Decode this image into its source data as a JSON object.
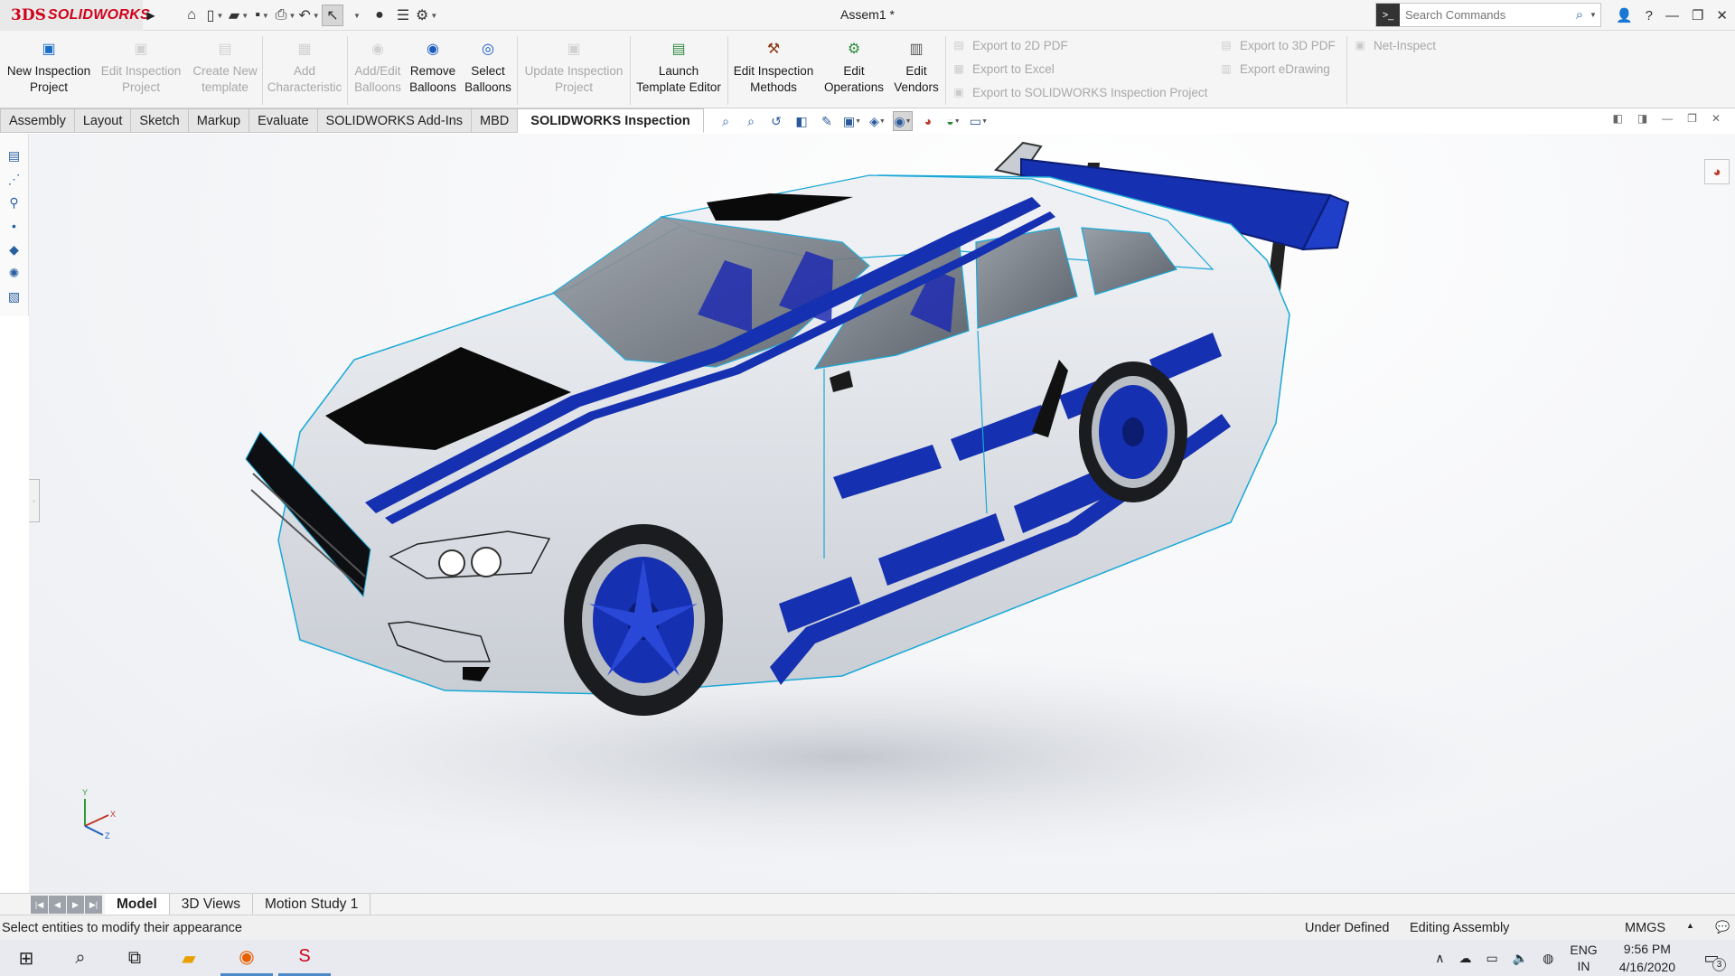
{
  "app": {
    "brand_mark": "3DS",
    "brand_name": "SOLIDWORKS",
    "document_title": "Assem1 *"
  },
  "search": {
    "placeholder": "Search Commands"
  },
  "quick_toolbar": {
    "icons": [
      "home-icon",
      "new-document-icon",
      "open-folder-icon",
      "save-icon",
      "print-icon",
      "undo-icon",
      "select-pointer-icon",
      "traffic-light-icon",
      "file-properties-icon",
      "options-gear-icon"
    ]
  },
  "ribbon": {
    "new_inspection_project": "New Inspection Project",
    "edit_inspection_project": "Edit Inspection Project",
    "create_new_template": "Create New template",
    "add_characteristic": "Add Characteristic",
    "add_edit_balloons": "Add/Edit Balloons",
    "remove_balloons": "Remove Balloons",
    "select_balloons": "Select Balloons",
    "update_inspection_project": "Update Inspection Project",
    "launch_template_editor": "Launch Template Editor",
    "edit_inspection_methods": "Edit Inspection Methods",
    "edit_operations": "Edit Operations",
    "edit_vendors": "Edit Vendors",
    "export_2d_pdf": "Export to 2D PDF",
    "export_excel": "Export to Excel",
    "export_sw_inspection": "Export to SOLIDWORKS Inspection Project",
    "export_3d_pdf": "Export to 3D PDF",
    "export_edrawing": "Export eDrawing",
    "net_inspect": "Net-Inspect"
  },
  "tabs": [
    "Assembly",
    "Layout",
    "Sketch",
    "Markup",
    "Evaluate",
    "SOLIDWORKS Add-Ins",
    "MBD",
    "SOLIDWORKS Inspection"
  ],
  "active_tab": "SOLIDWORKS Inspection",
  "triad": {
    "y": "Y",
    "x": "X",
    "z": "Z"
  },
  "bottom_tabs": [
    "Model",
    "3D Views",
    "Motion Study 1"
  ],
  "status": {
    "message": "Select entities to modify their appearance",
    "definition": "Under Defined",
    "mode": "Editing Assembly",
    "units": "MMGS"
  },
  "taskbar": {
    "lang_top": "ENG",
    "lang_bottom": "IN",
    "time": "9:56 PM",
    "date": "4/16/2020",
    "notifications": "3"
  },
  "colors": {
    "brand_red": "#d0021b",
    "car_body": "#e4e7ec",
    "car_stripe": "#1530b0",
    "edge_lines": "#18a8d6"
  }
}
